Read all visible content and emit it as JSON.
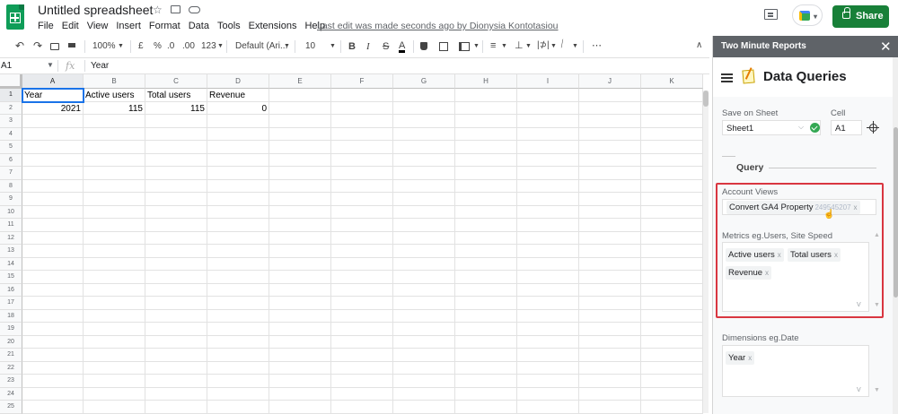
{
  "header": {
    "doc_title": "Untitled spreadsheet",
    "menu": [
      "File",
      "Edit",
      "View",
      "Insert",
      "Format",
      "Data",
      "Tools",
      "Extensions",
      "Help"
    ],
    "last_edit": "Last edit was made seconds ago by Dionysia Kontotasiou",
    "share_label": "Share"
  },
  "toolbar": {
    "zoom": "100%",
    "currency": "£",
    "percent": "%",
    "decimal_less": ".0",
    "decimal_more": ".00",
    "number_format": "123",
    "font": "Default (Ari...",
    "font_size": "10",
    "bold": "B",
    "italic": "I",
    "strikethrough": "S",
    "text_color": "A",
    "more": "⋯"
  },
  "formula_bar": {
    "name_box": "A1",
    "fx": "fx",
    "value": "Year"
  },
  "grid": {
    "columns": [
      "A",
      "B",
      "C",
      "D",
      "E",
      "F",
      "G",
      "H",
      "I",
      "J",
      "K"
    ],
    "row_numbers": [
      "1",
      "2",
      "3",
      "4",
      "5",
      "6",
      "7",
      "8",
      "9",
      "10",
      "11",
      "12",
      "13",
      "14",
      "15",
      "16",
      "17",
      "18",
      "19",
      "20",
      "21",
      "22",
      "23",
      "24",
      "25"
    ],
    "rows": [
      [
        "Year",
        "Active users",
        "Total users",
        "Revenue"
      ],
      [
        "2021",
        "115",
        "115",
        "0"
      ]
    ]
  },
  "panel": {
    "title": "Two Minute Reports",
    "close": "✕",
    "heading": "Data Queries",
    "save_on_sheet_label": "Save on Sheet",
    "sheet_value": "Sheet1",
    "cell_label": "Cell",
    "cell_value": "A1",
    "query_label": "Query",
    "account_views_label": "Account Views",
    "account_chip": "Convert GA4 Property",
    "account_chip_id": "249545207",
    "metrics_label": "Metrics eg.Users, Site Speed",
    "metrics": [
      "Active users",
      "Total users",
      "Revenue"
    ],
    "dimensions_label": "Dimensions eg.Date",
    "dimensions": [
      "Year"
    ],
    "chip_remove": "x",
    "dropdown_arrow": "V"
  }
}
